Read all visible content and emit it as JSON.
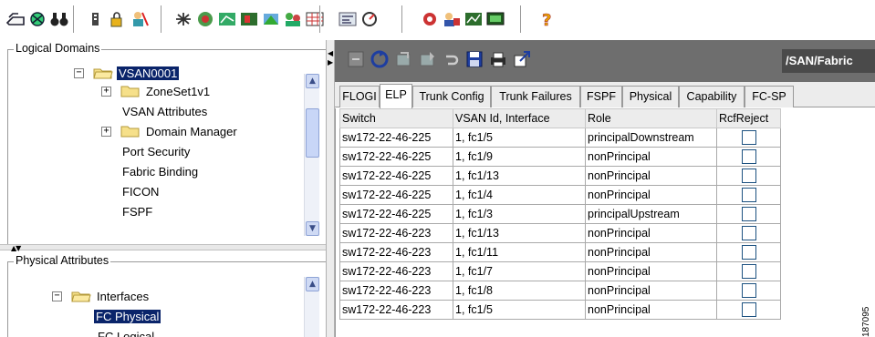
{
  "toolbar": {
    "groups": [
      [
        "open-icon",
        "discover-icon",
        "binoculars-icon"
      ],
      [
        "list-icon",
        "lock-icon",
        "user-icon"
      ],
      [
        "zone-icon",
        "topology-icon",
        "report-icon",
        "map-icon",
        "fabric-icon",
        "users-icon",
        "grid-icon"
      ],
      [
        "flow-icon",
        "performance-icon"
      ],
      [
        "device-icon",
        "users-group-icon",
        "chart-icon",
        "monitor-icon"
      ],
      [
        "help-icon"
      ]
    ]
  },
  "logical_domains": {
    "legend": "Logical Domains",
    "items": [
      {
        "label": "VSAN0001",
        "expander": "−",
        "selected": true
      },
      {
        "label": "ZoneSet1v1",
        "expander": "+"
      },
      {
        "label": "VSAN Attributes"
      },
      {
        "label": "Domain Manager",
        "expander": "+"
      },
      {
        "label": "Port Security"
      },
      {
        "label": "Fabric Binding"
      },
      {
        "label": "FICON"
      },
      {
        "label": "FSPF"
      }
    ]
  },
  "physical_attributes": {
    "legend": "Physical Attributes",
    "items": [
      {
        "label": "Interfaces",
        "expander": "−"
      },
      {
        "label": "FC Physical",
        "selected": true
      },
      {
        "label": "FC Logical"
      }
    ]
  },
  "right_toolbar": {
    "icons": [
      "refresh-icon",
      "update-icon",
      "apply-icon",
      "create-icon",
      "undo-icon",
      "save-icon",
      "print-icon",
      "export-icon"
    ],
    "title": "/SAN/Fabric"
  },
  "tabs": [
    {
      "label": "FLOGI"
    },
    {
      "label": "ELP",
      "active": true
    },
    {
      "label": "Trunk Config"
    },
    {
      "label": "Trunk Failures"
    },
    {
      "label": "FSPF"
    },
    {
      "label": "Physical"
    },
    {
      "label": "Capability"
    },
    {
      "label": "FC-SP"
    }
  ],
  "table": {
    "columns": [
      "Switch",
      "VSAN Id, Interface",
      "Role",
      "RcfReject"
    ],
    "rows": [
      {
        "switch": "sw172-22-46-225",
        "vsan": "1, fc1/5",
        "role": "principalDownstream"
      },
      {
        "switch": "sw172-22-46-225",
        "vsan": "1, fc1/9",
        "role": "nonPrincipal"
      },
      {
        "switch": "sw172-22-46-225",
        "vsan": "1, fc1/13",
        "role": "nonPrincipal"
      },
      {
        "switch": "sw172-22-46-225",
        "vsan": "1, fc1/4",
        "role": "nonPrincipal"
      },
      {
        "switch": "sw172-22-46-225",
        "vsan": "1, fc1/3",
        "role": "principalUpstream"
      },
      {
        "switch": "sw172-22-46-223",
        "vsan": "1, fc1/13",
        "role": "nonPrincipal"
      },
      {
        "switch": "sw172-22-46-223",
        "vsan": "1, fc1/11",
        "role": "nonPrincipal"
      },
      {
        "switch": "sw172-22-46-223",
        "vsan": "1, fc1/7",
        "role": "nonPrincipal"
      },
      {
        "switch": "sw172-22-46-223",
        "vsan": "1, fc1/8",
        "role": "nonPrincipal"
      },
      {
        "switch": "sw172-22-46-223",
        "vsan": "1, fc1/5",
        "role": "nonPrincipal"
      }
    ]
  },
  "watermark": "187095"
}
